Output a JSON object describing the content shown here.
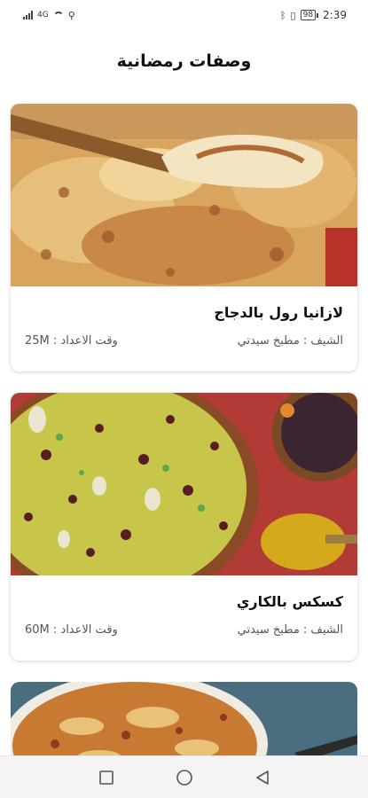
{
  "status_bar": {
    "signal_text": "4G",
    "battery": "98",
    "time": "2:39",
    "icons": [
      "signal-icon",
      "wifi-icon",
      "usb-icon",
      "bluetooth-icon",
      "vibrate-icon",
      "battery-icon"
    ]
  },
  "page": {
    "title": "وصفات رمضانية"
  },
  "recipes": [
    {
      "title": "لازانيا رول بالدجاج",
      "chef": "الشيف : مطبخ سيدتي",
      "time": "وقت الاعداد : 25M",
      "image": "lasagna-photo"
    },
    {
      "title": "كسكس بالكاري",
      "chef": "الشيف : مطبخ سيدتي",
      "time": "وقت الاعداد : 60M",
      "image": "couscous-curry-photo"
    }
  ],
  "partial_card": {
    "image": "pasta-bake-photo"
  },
  "nav_bar": {
    "buttons": [
      "recents-square-icon",
      "home-circle-icon",
      "back-triangle-icon"
    ]
  },
  "colors": {
    "accent_text": "#111111",
    "secondary_text": "#555555",
    "nav_background": "#f4f4f4"
  }
}
